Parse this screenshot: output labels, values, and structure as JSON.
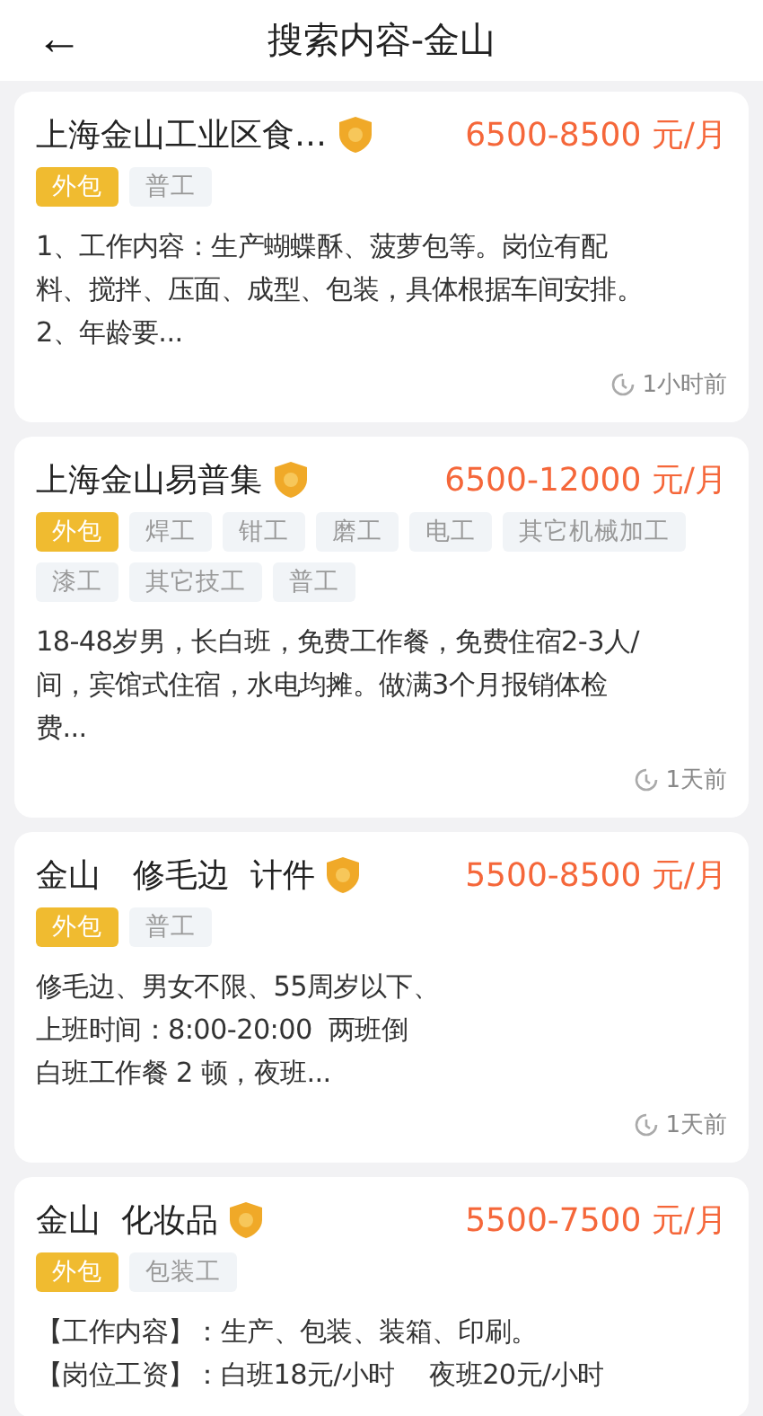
{
  "header": {
    "back": "←",
    "title": "搜索内容-金山"
  },
  "jobs": [
    {
      "title": "上海金山工业区食…",
      "salary": "6500-8500 元/月",
      "tags": [
        {
          "label": "外包",
          "kind": "outsource"
        },
        {
          "label": "普工",
          "kind": "category"
        }
      ],
      "description": [
        "1、工作内容：生产蝴蝶酥、菠萝包等。岗位有配",
        "料、搅拌、压面、成型、包装，具体根据车间安排。",
        "2、年龄要..."
      ],
      "time": "1小时前"
    },
    {
      "title": "上海金山易普集",
      "salary": "6500-12000 元/月",
      "tags": [
        {
          "label": "外包",
          "kind": "outsource"
        },
        {
          "label": "焊工",
          "kind": "category"
        },
        {
          "label": "钳工",
          "kind": "category"
        },
        {
          "label": "磨工",
          "kind": "category"
        },
        {
          "label": "电工",
          "kind": "category"
        },
        {
          "label": "其它机械加工",
          "kind": "category"
        },
        {
          "label": "漆工",
          "kind": "category"
        },
        {
          "label": "其它技工",
          "kind": "category"
        },
        {
          "label": "普工",
          "kind": "category"
        }
      ],
      "description": [
        "18-48岁男，长白班，免费工作餐，免费住宿2-3人/",
        "间，宾馆式住宿，水电均摊。做满3个月报销体检",
        "费..."
      ],
      "time": "1天前"
    },
    {
      "title": "金山　修毛边  计件",
      "salary": "5500-8500 元/月",
      "tags": [
        {
          "label": "外包",
          "kind": "outsource"
        },
        {
          "label": "普工",
          "kind": "category"
        }
      ],
      "description": [
        "修毛边、男女不限、55周岁以下、",
        "上班时间：8:00-20:00  两班倒",
        "白班工作餐 2 顿，夜班..."
      ],
      "time": "1天前"
    },
    {
      "title": "金山  化妆品",
      "salary": "5500-7500 元/月",
      "tags": [
        {
          "label": "外包",
          "kind": "outsource"
        },
        {
          "label": "包装工",
          "kind": "category"
        }
      ],
      "description": [
        "【工作内容】：生产、包装、装箱、印刷。",
        "【岗位工资】：白班18元/小时　 夜班20元/小时"
      ]
    }
  ]
}
